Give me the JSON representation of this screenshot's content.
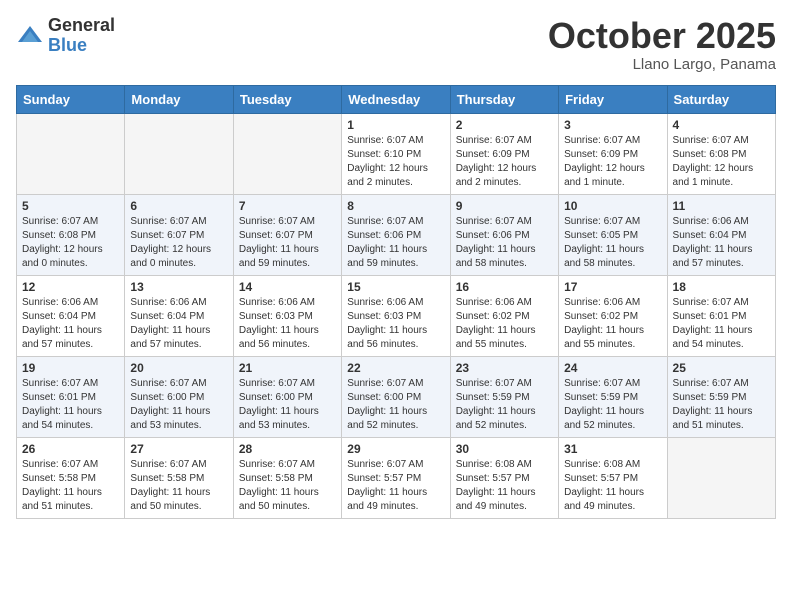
{
  "header": {
    "logo_general": "General",
    "logo_blue": "Blue",
    "month": "October 2025",
    "location": "Llano Largo, Panama"
  },
  "weekdays": [
    "Sunday",
    "Monday",
    "Tuesday",
    "Wednesday",
    "Thursday",
    "Friday",
    "Saturday"
  ],
  "weeks": [
    [
      {
        "day": "",
        "info": ""
      },
      {
        "day": "",
        "info": ""
      },
      {
        "day": "",
        "info": ""
      },
      {
        "day": "1",
        "info": "Sunrise: 6:07 AM\nSunset: 6:10 PM\nDaylight: 12 hours\nand 2 minutes."
      },
      {
        "day": "2",
        "info": "Sunrise: 6:07 AM\nSunset: 6:09 PM\nDaylight: 12 hours\nand 2 minutes."
      },
      {
        "day": "3",
        "info": "Sunrise: 6:07 AM\nSunset: 6:09 PM\nDaylight: 12 hours\nand 1 minute."
      },
      {
        "day": "4",
        "info": "Sunrise: 6:07 AM\nSunset: 6:08 PM\nDaylight: 12 hours\nand 1 minute."
      }
    ],
    [
      {
        "day": "5",
        "info": "Sunrise: 6:07 AM\nSunset: 6:08 PM\nDaylight: 12 hours\nand 0 minutes."
      },
      {
        "day": "6",
        "info": "Sunrise: 6:07 AM\nSunset: 6:07 PM\nDaylight: 12 hours\nand 0 minutes."
      },
      {
        "day": "7",
        "info": "Sunrise: 6:07 AM\nSunset: 6:07 PM\nDaylight: 11 hours\nand 59 minutes."
      },
      {
        "day": "8",
        "info": "Sunrise: 6:07 AM\nSunset: 6:06 PM\nDaylight: 11 hours\nand 59 minutes."
      },
      {
        "day": "9",
        "info": "Sunrise: 6:07 AM\nSunset: 6:06 PM\nDaylight: 11 hours\nand 58 minutes."
      },
      {
        "day": "10",
        "info": "Sunrise: 6:07 AM\nSunset: 6:05 PM\nDaylight: 11 hours\nand 58 minutes."
      },
      {
        "day": "11",
        "info": "Sunrise: 6:06 AM\nSunset: 6:04 PM\nDaylight: 11 hours\nand 57 minutes."
      }
    ],
    [
      {
        "day": "12",
        "info": "Sunrise: 6:06 AM\nSunset: 6:04 PM\nDaylight: 11 hours\nand 57 minutes."
      },
      {
        "day": "13",
        "info": "Sunrise: 6:06 AM\nSunset: 6:04 PM\nDaylight: 11 hours\nand 57 minutes."
      },
      {
        "day": "14",
        "info": "Sunrise: 6:06 AM\nSunset: 6:03 PM\nDaylight: 11 hours\nand 56 minutes."
      },
      {
        "day": "15",
        "info": "Sunrise: 6:06 AM\nSunset: 6:03 PM\nDaylight: 11 hours\nand 56 minutes."
      },
      {
        "day": "16",
        "info": "Sunrise: 6:06 AM\nSunset: 6:02 PM\nDaylight: 11 hours\nand 55 minutes."
      },
      {
        "day": "17",
        "info": "Sunrise: 6:06 AM\nSunset: 6:02 PM\nDaylight: 11 hours\nand 55 minutes."
      },
      {
        "day": "18",
        "info": "Sunrise: 6:07 AM\nSunset: 6:01 PM\nDaylight: 11 hours\nand 54 minutes."
      }
    ],
    [
      {
        "day": "19",
        "info": "Sunrise: 6:07 AM\nSunset: 6:01 PM\nDaylight: 11 hours\nand 54 minutes."
      },
      {
        "day": "20",
        "info": "Sunrise: 6:07 AM\nSunset: 6:00 PM\nDaylight: 11 hours\nand 53 minutes."
      },
      {
        "day": "21",
        "info": "Sunrise: 6:07 AM\nSunset: 6:00 PM\nDaylight: 11 hours\nand 53 minutes."
      },
      {
        "day": "22",
        "info": "Sunrise: 6:07 AM\nSunset: 6:00 PM\nDaylight: 11 hours\nand 52 minutes."
      },
      {
        "day": "23",
        "info": "Sunrise: 6:07 AM\nSunset: 5:59 PM\nDaylight: 11 hours\nand 52 minutes."
      },
      {
        "day": "24",
        "info": "Sunrise: 6:07 AM\nSunset: 5:59 PM\nDaylight: 11 hours\nand 52 minutes."
      },
      {
        "day": "25",
        "info": "Sunrise: 6:07 AM\nSunset: 5:59 PM\nDaylight: 11 hours\nand 51 minutes."
      }
    ],
    [
      {
        "day": "26",
        "info": "Sunrise: 6:07 AM\nSunset: 5:58 PM\nDaylight: 11 hours\nand 51 minutes."
      },
      {
        "day": "27",
        "info": "Sunrise: 6:07 AM\nSunset: 5:58 PM\nDaylight: 11 hours\nand 50 minutes."
      },
      {
        "day": "28",
        "info": "Sunrise: 6:07 AM\nSunset: 5:58 PM\nDaylight: 11 hours\nand 50 minutes."
      },
      {
        "day": "29",
        "info": "Sunrise: 6:07 AM\nSunset: 5:57 PM\nDaylight: 11 hours\nand 49 minutes."
      },
      {
        "day": "30",
        "info": "Sunrise: 6:08 AM\nSunset: 5:57 PM\nDaylight: 11 hours\nand 49 minutes."
      },
      {
        "day": "31",
        "info": "Sunrise: 6:08 AM\nSunset: 5:57 PM\nDaylight: 11 hours\nand 49 minutes."
      },
      {
        "day": "",
        "info": ""
      }
    ]
  ]
}
